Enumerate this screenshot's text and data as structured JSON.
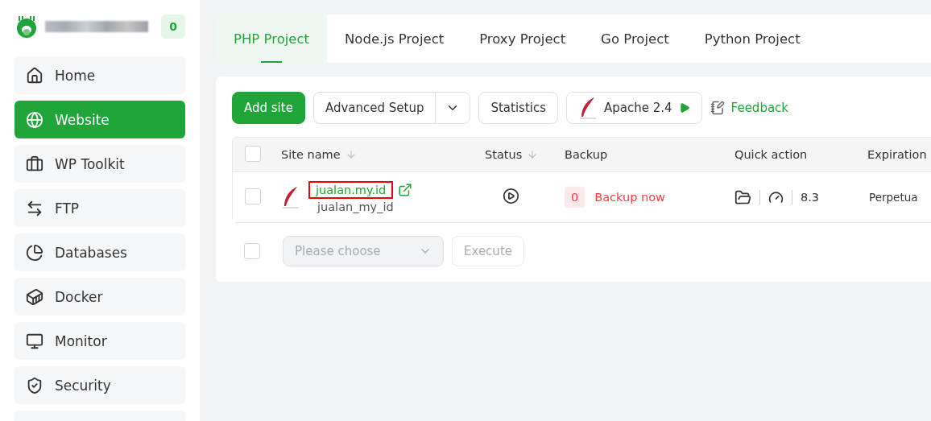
{
  "sidebar": {
    "badge": "0",
    "items": [
      {
        "label": "Home",
        "selected": false
      },
      {
        "label": "Website",
        "selected": true
      },
      {
        "label": "WP Toolkit",
        "selected": false
      },
      {
        "label": "FTP",
        "selected": false
      },
      {
        "label": "Databases",
        "selected": false
      },
      {
        "label": "Docker",
        "selected": false
      },
      {
        "label": "Monitor",
        "selected": false
      },
      {
        "label": "Security",
        "selected": false
      },
      {
        "selected": false
      }
    ]
  },
  "tabs": [
    {
      "label": "PHP Project",
      "selected": true
    },
    {
      "label": "Node.js Project",
      "selected": false
    },
    {
      "label": "Proxy Project",
      "selected": false
    },
    {
      "label": "Go Project",
      "selected": false
    },
    {
      "label": "Python Project",
      "selected": false
    }
  ],
  "toolbar": {
    "add": "Add site",
    "advanced": "Advanced Setup",
    "statistics": "Statistics",
    "server": "Apache 2.4",
    "feedback": "Feedback"
  },
  "table": {
    "header_checked": false,
    "columns": [
      "Site name",
      "Status",
      "Backup",
      "Quick action",
      "Expiration"
    ],
    "rows": [
      {
        "checked": false,
        "domain": "jualan.my.id",
        "name": "jualan_my_id",
        "backup_count": "0",
        "backup_action": "Backup now",
        "php": "8.3",
        "expiration": "Perpetua"
      }
    ]
  },
  "bulk": {
    "checked": false,
    "placeholder": "Please choose",
    "execute": "Execute"
  }
}
